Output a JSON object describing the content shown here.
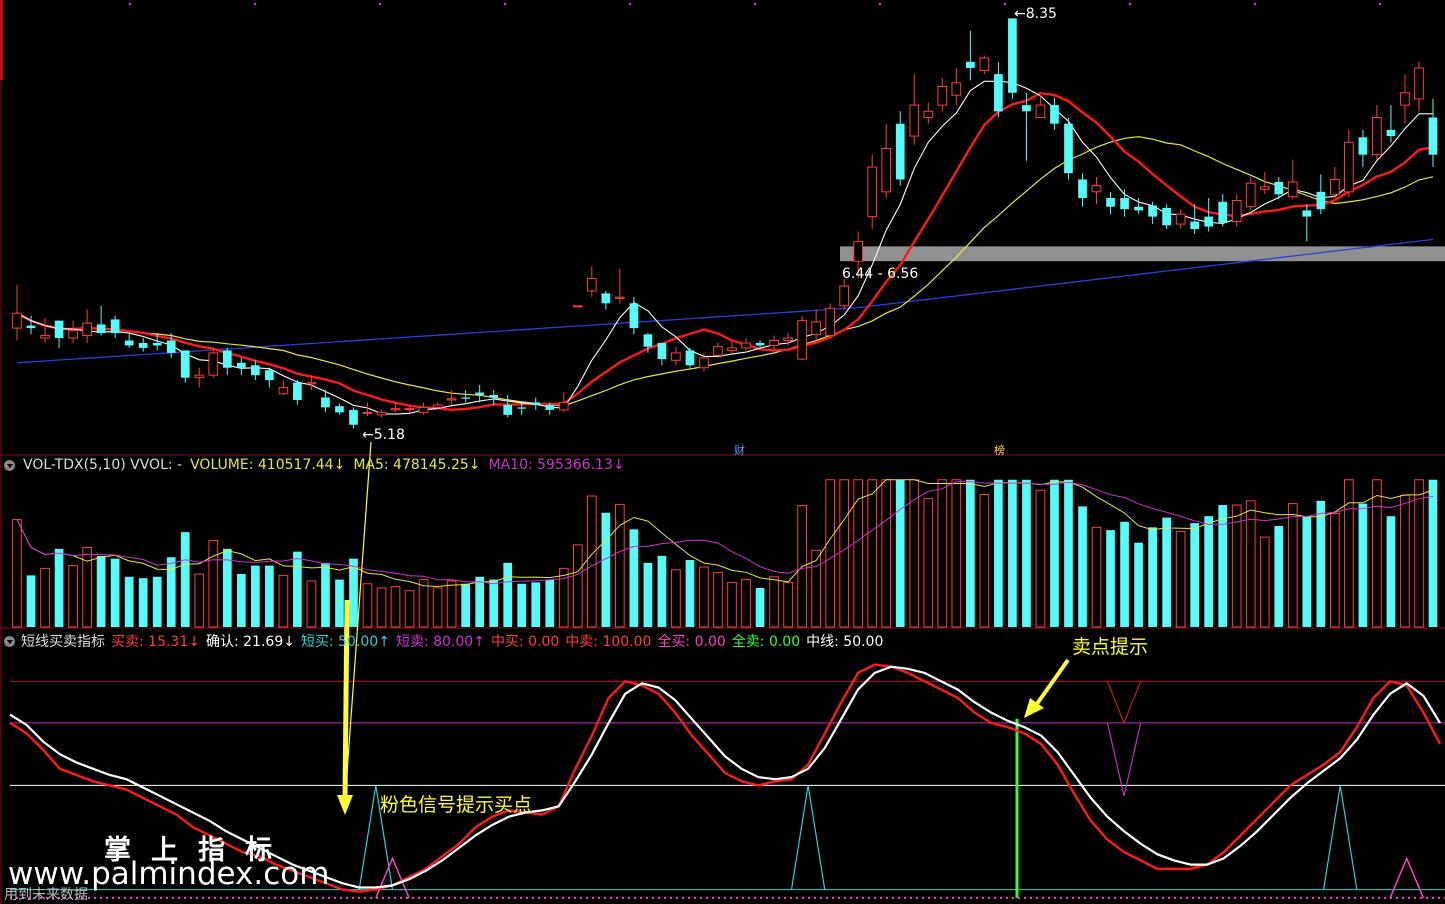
{
  "colors": {
    "up": "#ff3b3b",
    "down": "#54fcfc",
    "ma_white": "#ffffff",
    "ma_red": "#ff1a1a",
    "ma_yellow": "#e8e83a",
    "ma_blue": "#2b3fe0",
    "band": "#909090",
    "vol_ma5": "#e8e83a",
    "vol_ma10": "#d030d0",
    "arrow": "#ffff33",
    "pink_signal": "#ff40c0",
    "cyan_signal": "#30d0d0",
    "sell_bar": "#33ff33"
  },
  "price_panel": {
    "band_label": "6.44 - 6.56",
    "low_label": "5.18",
    "high_label": "8.35",
    "marker_cai": "财",
    "marker_bang": "榜"
  },
  "volume_header": {
    "name": "VOL-TDX(5,10) VVOL: -",
    "volume": "VOLUME: 410517.44↓",
    "ma5": "MA5: 478145.25↓",
    "ma10": "MA10: 595366.13↓"
  },
  "indicator_header": {
    "name": "短线买卖指标",
    "buysell": "买卖: 15.31↓",
    "confirm": "确认: 21.69↓",
    "short_buy": "短买: 50.00↑",
    "short_sell": "短卖: 80.00↑",
    "mid_buy": "中买: 0.00",
    "mid_sell": "中卖: 100.00",
    "all_buy": "全买: 0.00",
    "all_sell": "全卖: 0.00",
    "midline": "中线: 50.00"
  },
  "annotations": {
    "buy_hint": "粉色信号提示买点",
    "sell_hint": "卖点提示"
  },
  "watermark": {
    "title": "掌上指标",
    "url": "www.palmindex.com",
    "note": "用到未来数据"
  },
  "chart_data": {
    "type": "candlestick",
    "price": {
      "ylim": [
        4.9,
        8.5
      ],
      "band": [
        6.44,
        6.56
      ],
      "low": 5.18,
      "high": 8.35,
      "candles": [
        [
          5.9,
          6.02,
          6.25,
          5.8
        ],
        [
          5.92,
          5.9,
          6.0,
          5.85
        ],
        [
          5.82,
          5.84,
          5.98,
          5.78
        ],
        [
          5.96,
          5.82,
          5.96,
          5.74
        ],
        [
          5.82,
          5.88,
          5.96,
          5.78
        ],
        [
          5.84,
          5.94,
          6.05,
          5.78
        ],
        [
          5.93,
          5.86,
          6.08,
          5.84
        ],
        [
          5.97,
          5.86,
          6.0,
          5.82
        ],
        [
          5.8,
          5.76,
          5.86,
          5.74
        ],
        [
          5.78,
          5.74,
          5.82,
          5.71
        ],
        [
          5.78,
          5.76,
          5.86,
          5.72
        ],
        [
          5.8,
          5.7,
          5.86,
          5.66
        ],
        [
          5.72,
          5.5,
          5.72,
          5.46
        ],
        [
          5.5,
          5.52,
          5.58,
          5.42
        ],
        [
          5.52,
          5.7,
          5.74,
          5.5
        ],
        [
          5.72,
          5.58,
          5.74,
          5.52
        ],
        [
          5.62,
          5.58,
          5.66,
          5.52
        ],
        [
          5.6,
          5.52,
          5.64,
          5.48
        ],
        [
          5.56,
          5.48,
          5.58,
          5.42
        ],
        [
          5.37,
          5.42,
          5.48,
          5.36
        ],
        [
          5.46,
          5.32,
          5.48,
          5.28
        ],
        [
          5.45,
          5.46,
          5.52,
          5.4
        ],
        [
          5.34,
          5.26,
          5.4,
          5.22
        ],
        [
          5.27,
          5.22,
          5.29,
          5.2
        ],
        [
          5.24,
          5.12,
          5.26,
          5.09
        ],
        [
          5.22,
          5.22,
          5.3,
          5.19
        ],
        [
          5.2,
          5.22,
          5.24,
          5.18
        ],
        [
          5.24,
          5.25,
          5.3,
          5.22
        ],
        [
          5.25,
          5.25,
          5.28,
          5.22
        ],
        [
          5.22,
          5.26,
          5.3,
          5.2
        ],
        [
          5.26,
          5.28,
          5.3,
          5.24
        ],
        [
          5.32,
          5.33,
          5.4,
          5.28
        ],
        [
          5.34,
          5.33,
          5.4,
          5.3
        ],
        [
          5.38,
          5.36,
          5.44,
          5.3
        ],
        [
          5.36,
          5.34,
          5.4,
          5.28
        ],
        [
          5.28,
          5.2,
          5.36,
          5.18
        ],
        [
          5.26,
          5.25,
          5.3,
          5.2
        ],
        [
          5.3,
          5.28,
          5.34,
          5.24
        ],
        [
          5.28,
          5.24,
          5.3,
          5.2
        ],
        [
          5.24,
          5.3,
          5.38,
          5.22
        ],
        [
          6.08,
          6.08,
          6.08,
          6.08
        ],
        [
          6.2,
          6.3,
          6.4,
          6.15
        ],
        [
          6.18,
          6.1,
          6.2,
          6.05
        ],
        [
          6.14,
          6.15,
          6.38,
          6.1
        ],
        [
          6.1,
          5.9,
          6.15,
          5.85
        ],
        [
          5.85,
          5.75,
          5.86,
          5.7
        ],
        [
          5.78,
          5.65,
          5.78,
          5.6
        ],
        [
          5.64,
          5.7,
          5.75,
          5.6
        ],
        [
          5.72,
          5.6,
          5.74,
          5.58
        ],
        [
          5.58,
          5.66,
          5.7,
          5.55
        ],
        [
          5.68,
          5.75,
          5.78,
          5.66
        ],
        [
          5.72,
          5.74,
          5.8,
          5.7
        ],
        [
          5.74,
          5.78,
          5.82,
          5.72
        ],
        [
          5.78,
          5.76,
          5.8,
          5.74
        ],
        [
          5.76,
          5.8,
          5.84,
          5.72
        ],
        [
          5.8,
          5.82,
          5.86,
          5.76
        ],
        [
          5.65,
          5.96,
          6.0,
          5.64
        ],
        [
          5.85,
          5.95,
          6.05,
          5.8
        ],
        [
          5.84,
          6.06,
          6.1,
          5.82
        ],
        [
          6.08,
          6.24,
          6.3,
          6.05
        ],
        [
          6.44,
          6.6,
          6.68,
          6.3
        ],
        [
          6.8,
          7.2,
          7.3,
          6.7
        ],
        [
          7.0,
          7.35,
          7.55,
          6.95
        ],
        [
          7.55,
          7.1,
          7.65,
          7.05
        ],
        [
          7.45,
          7.7,
          7.95,
          7.38
        ],
        [
          7.6,
          7.65,
          7.72,
          7.55
        ],
        [
          7.7,
          7.85,
          7.92,
          7.65
        ],
        [
          7.78,
          7.88,
          8.0,
          7.7
        ],
        [
          8.05,
          8.0,
          8.3,
          7.9
        ],
        [
          7.98,
          8.08,
          8.1,
          7.95
        ],
        [
          7.95,
          7.65,
          8.05,
          7.6
        ],
        [
          8.4,
          7.8,
          8.4,
          7.75
        ],
        [
          7.7,
          7.65,
          7.8,
          7.25
        ],
        [
          7.6,
          7.7,
          7.78,
          7.6
        ],
        [
          7.7,
          7.55,
          7.76,
          7.5
        ],
        [
          7.55,
          7.15,
          7.6,
          7.1
        ],
        [
          7.1,
          6.95,
          7.15,
          6.88
        ],
        [
          7.0,
          7.05,
          7.12,
          6.9
        ],
        [
          6.95,
          6.88,
          7.0,
          6.82
        ],
        [
          6.95,
          6.86,
          7.02,
          6.8
        ],
        [
          6.88,
          6.85,
          6.95,
          6.82
        ],
        [
          6.89,
          6.8,
          6.92,
          6.74
        ],
        [
          6.87,
          6.73,
          6.9,
          6.7
        ],
        [
          6.74,
          6.82,
          6.86,
          6.7
        ],
        [
          6.76,
          6.7,
          6.9,
          6.66
        ],
        [
          6.8,
          6.72,
          6.95,
          6.68
        ],
        [
          6.92,
          6.75,
          6.98,
          6.72
        ],
        [
          6.76,
          6.93,
          6.98,
          6.72
        ],
        [
          6.88,
          7.07,
          7.12,
          6.85
        ],
        [
          7.02,
          7.04,
          7.16,
          6.98
        ],
        [
          7.08,
          6.98,
          7.12,
          6.94
        ],
        [
          6.96,
          7.08,
          7.26,
          6.94
        ],
        [
          6.85,
          6.8,
          6.9,
          6.6
        ],
        [
          7.0,
          6.86,
          7.14,
          6.82
        ],
        [
          6.98,
          7.1,
          7.2,
          6.95
        ],
        [
          7.0,
          7.4,
          7.5,
          6.96
        ],
        [
          7.44,
          7.3,
          7.5,
          7.2
        ],
        [
          7.3,
          7.6,
          7.7,
          7.26
        ],
        [
          7.5,
          7.45,
          7.7,
          7.4
        ],
        [
          7.7,
          7.8,
          7.95,
          7.55
        ],
        [
          7.75,
          8.0,
          8.05,
          7.65
        ],
        [
          7.6,
          7.3,
          7.75,
          7.2
        ]
      ]
    },
    "volume": {
      "volume_last": 410517.44,
      "ma5_last": 478145.25,
      "ma10_last": 595366.13
    },
    "indicator": {
      "ylim": [
        -5,
        115
      ],
      "buysell_last": 15.31,
      "confirm_last": 21.69,
      "short_buy": 50.0,
      "short_sell": 80.0,
      "mid_buy": 0.0,
      "mid_sell": 100.0,
      "all_buy": 0.0,
      "all_sell": 0.0,
      "midline": 50.0,
      "buysell": [
        80,
        75,
        67,
        58,
        55,
        52,
        50,
        48,
        44,
        40,
        36,
        30,
        26,
        22,
        18,
        16,
        12,
        9,
        6,
        3,
        0,
        -1,
        0,
        2,
        6,
        10,
        16,
        22,
        30,
        35,
        38,
        37,
        36,
        40,
        58,
        74,
        92,
        100,
        98,
        94,
        85,
        74,
        65,
        56,
        52,
        50,
        52,
        53,
        60,
        75,
        90,
        104,
        108,
        107,
        104,
        100,
        96,
        92,
        85,
        80,
        78,
        75,
        70,
        60,
        46,
        33,
        24,
        18,
        14,
        10,
        10,
        10,
        12,
        18,
        26,
        34,
        42,
        50,
        55,
        60,
        66,
        78,
        92,
        100,
        98,
        85,
        70
      ],
      "confirm": [
        84,
        79,
        71,
        65,
        61,
        58,
        55,
        53,
        49,
        45,
        41,
        37,
        33,
        28,
        24,
        20,
        16,
        12,
        9,
        6,
        3,
        1,
        1,
        2,
        5,
        9,
        14,
        20,
        26,
        31,
        35,
        37,
        38,
        40,
        52,
        65,
        80,
        94,
        99,
        97,
        91,
        82,
        73,
        64,
        58,
        54,
        53,
        54,
        58,
        68,
        82,
        96,
        104,
        107,
        106,
        104,
        100,
        96,
        90,
        85,
        81,
        78,
        74,
        66,
        55,
        44,
        35,
        28,
        22,
        17,
        14,
        12,
        12,
        15,
        21,
        28,
        36,
        44,
        51,
        57,
        63,
        72,
        84,
        94,
        99,
        93,
        80
      ]
    }
  }
}
